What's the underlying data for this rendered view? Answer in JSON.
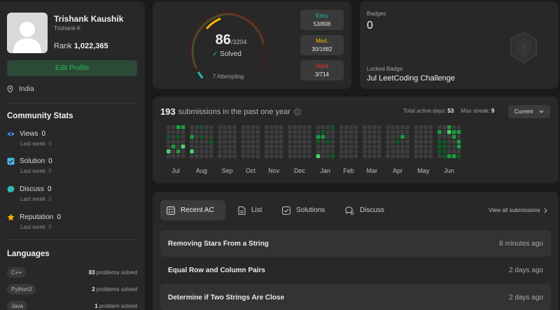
{
  "profile": {
    "name": "Trishank Kaushik",
    "username": "Trishank-K",
    "rank_label": "Rank",
    "rank_value": "1,022,365",
    "edit_label": "Edit Profile",
    "location": "India"
  },
  "community": {
    "title": "Community Stats",
    "items": [
      {
        "label": "Views",
        "value": "0",
        "sub_label": "Last week",
        "sub_value": "0",
        "icon": "eye-icon",
        "color": "#3e9bff"
      },
      {
        "label": "Solution",
        "value": "0",
        "sub_label": "Last week",
        "sub_value": "0",
        "icon": "check-square-icon",
        "color": "#4ab3e6"
      },
      {
        "label": "Discuss",
        "value": "0",
        "sub_label": "Last week",
        "sub_value": "0",
        "icon": "chat-icon",
        "color": "#2cbbb0"
      },
      {
        "label": "Reputation",
        "value": "0",
        "sub_label": "Last week",
        "sub_value": "0",
        "icon": "star-icon",
        "color": "#ffb800"
      }
    ]
  },
  "languages": {
    "title": "Languages",
    "items": [
      {
        "name": "C++",
        "count": "83",
        "suffix": "problems solved"
      },
      {
        "name": "Python3",
        "count": "2",
        "suffix": "problems solved"
      },
      {
        "name": "Java",
        "count": "1",
        "suffix": "problem solved"
      }
    ]
  },
  "solved": {
    "count": "86",
    "total": "/3204",
    "label": "Solved",
    "attempting": "7 Attempting",
    "progress": 0.0268,
    "difficulties": [
      {
        "label": "Easy",
        "value": "53/808",
        "color": "#1cbaba"
      },
      {
        "label": "Med.",
        "value": "30/1682",
        "color": "#ffb700"
      },
      {
        "label": "Hard",
        "value": "3/714",
        "color": "#f63737"
      }
    ]
  },
  "badges": {
    "title": "Badges",
    "count": "0",
    "locked_label": "Locked Badge",
    "locked_name": "Jul LeetCoding Challenge"
  },
  "heatmap": {
    "count": "193",
    "title": "submissions in the past one year",
    "active_label": "Total active days:",
    "active_value": "53",
    "streak_label": "Max streak:",
    "streak_value": "9",
    "dropdown": "Current",
    "months": [
      "Jul",
      "Aug",
      "Sep",
      "Oct",
      "Nov",
      "Dec",
      "Jan",
      "Feb",
      "Mar",
      "Apr",
      "May",
      "Jun"
    ],
    "colors": {
      "empty": "#3e3e3e",
      "low": "#0e5a27",
      "mid": "#1e9b42",
      "high": "#4fd26f"
    }
  },
  "recent": {
    "tabs": [
      {
        "label": "Recent AC",
        "icon": "list-check-icon"
      },
      {
        "label": "List",
        "icon": "doc-icon"
      },
      {
        "label": "Solutions",
        "icon": "check-box-icon"
      },
      {
        "label": "Discuss",
        "icon": "discuss-icon"
      }
    ],
    "view_all": "View all submissions",
    "items": [
      {
        "title": "Removing Stars From a String",
        "time": "8 minutes ago"
      },
      {
        "title": "Equal Row and Column Pairs",
        "time": "2 days ago"
      },
      {
        "title": "Determine if Two Strings Are Close",
        "time": "2 days ago"
      }
    ]
  }
}
